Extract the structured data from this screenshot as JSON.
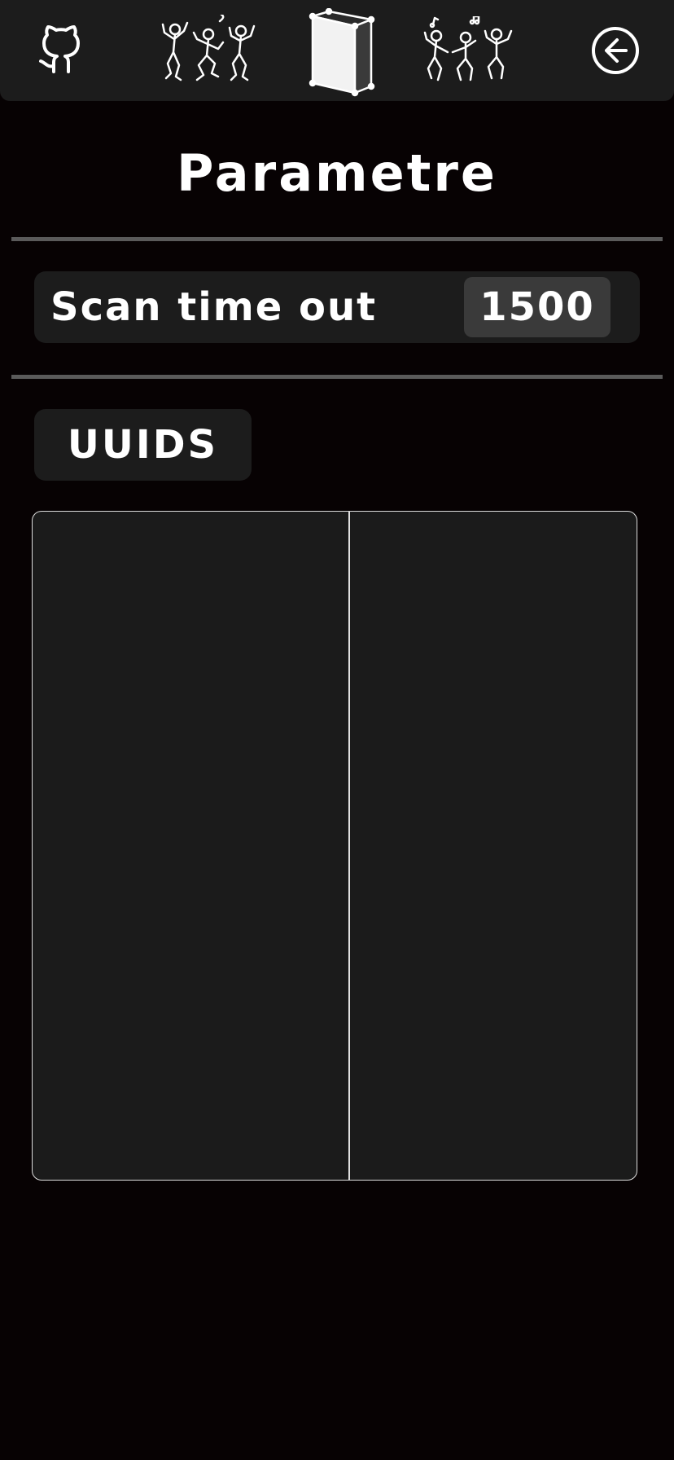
{
  "header": {
    "icons": [
      "github-icon",
      "dancers-icon",
      "speaker-icon",
      "dancers-icon",
      "back-arrow-icon"
    ]
  },
  "page": {
    "title": "Parametre"
  },
  "settings": {
    "scan_timeout_label": "Scan time out",
    "scan_timeout_value": "1500"
  },
  "uuids": {
    "button_label": "UUIDS",
    "columns": [],
    "rows": []
  },
  "colors": {
    "background": "#070203",
    "panel": "#1c1c1c",
    "input": "#3a3a3a",
    "divider": "#5a5a5a",
    "text": "#ffffff"
  }
}
